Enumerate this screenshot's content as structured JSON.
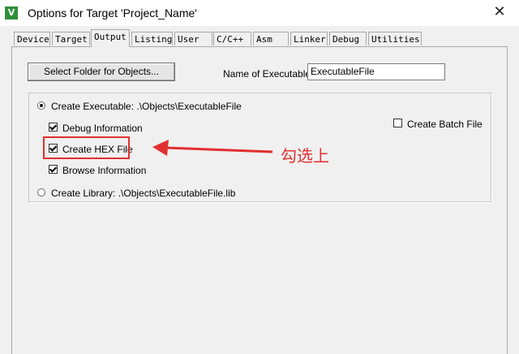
{
  "window": {
    "title": "Options for Target 'Project_Name'",
    "close_glyph": "✕",
    "icon": "keil-uvision-icon"
  },
  "tabs": [
    {
      "label": "Device",
      "active": false
    },
    {
      "label": "Target",
      "active": false
    },
    {
      "label": "Output",
      "active": true
    },
    {
      "label": "Listing",
      "active": false
    },
    {
      "label": "User",
      "active": false
    },
    {
      "label": "C/C++",
      "active": false
    },
    {
      "label": "Asm",
      "active": false
    },
    {
      "label": "Linker",
      "active": false
    },
    {
      "label": "Debug",
      "active": false
    },
    {
      "label": "Utilities",
      "active": false
    }
  ],
  "output": {
    "select_folder_label": "Select Folder for Objects...",
    "name_label": "Name of Executable:",
    "name_value": "ExecutableFile",
    "create_executable_label": "Create Executable:  .\\Objects\\ExecutableFile",
    "create_executable_selected": true,
    "debug_info_label": "Debug Information",
    "debug_info_checked": true,
    "create_hex_label": "Create HEX File",
    "create_hex_checked": true,
    "browse_info_label": "Browse Information",
    "browse_info_checked": true,
    "create_library_label": "Create Library:  .\\Objects\\ExecutableFile.lib",
    "create_library_selected": false,
    "create_batch_label": "Create Batch File",
    "create_batch_checked": false
  },
  "annotation": {
    "text": "勾选上",
    "color": "#e0302f"
  }
}
